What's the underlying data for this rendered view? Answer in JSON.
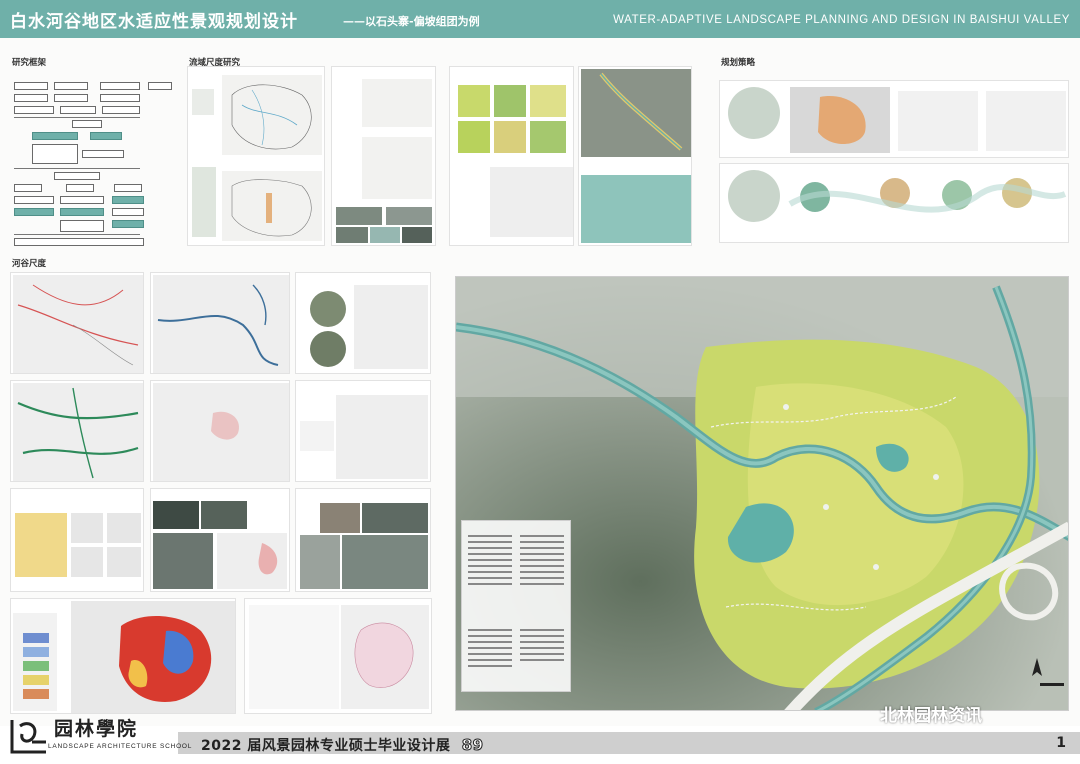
{
  "header": {
    "title_cn": "白水河谷地区水适应性景观规划设计",
    "subtitle_cn": "——以石头寨-偏坡组团为例",
    "title_en": "WATER-ADAPTIVE LANDSCAPE PLANNING AND DESIGN IN BAISHUI VALLEY"
  },
  "sections": {
    "research_framework": "研究框架",
    "basin_scale": "流域尺度研究",
    "planning_strategy": "规划策略",
    "valley_scale": "河谷尺度"
  },
  "footer": {
    "exhibition": "2022 届风景园林专业硕士毕业设计展",
    "exhibition_no": "89",
    "page": "1",
    "school_cn": "园林學院",
    "school_en": "LANDSCAPE ARCHITECTURE SCHOOL",
    "watermark": "北林园林资讯"
  },
  "colors": {
    "header_teal": "#6fb0a9",
    "footer_grey": "#cfcfcf"
  }
}
